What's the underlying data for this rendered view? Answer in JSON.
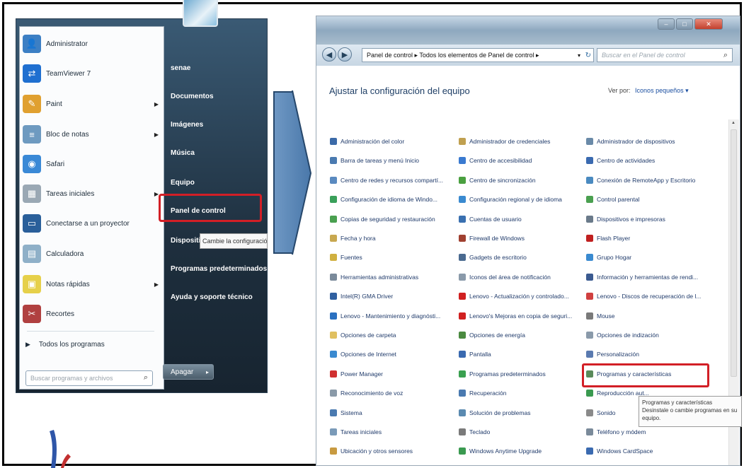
{
  "start_menu": {
    "items": [
      {
        "label": "Administrator",
        "icon": "administrator-icon",
        "color": "#3c7fc4",
        "arrow": false
      },
      {
        "label": "TeamViewer 7",
        "icon": "teamviewer-icon",
        "color": "#1f6fd0",
        "arrow": false
      },
      {
        "label": "Paint",
        "icon": "paint-icon",
        "color": "#e0a030",
        "arrow": true
      },
      {
        "label": "Bloc de notas",
        "icon": "notepad-icon",
        "color": "#6e9ac0",
        "arrow": true
      },
      {
        "label": "Safari",
        "icon": "safari-icon",
        "color": "#3a89d6",
        "arrow": false
      },
      {
        "label": "Tareas iniciales",
        "icon": "getting-started-icon",
        "color": "#9aa8b4",
        "arrow": true
      },
      {
        "label": "Conectarse a un proyector",
        "icon": "projector-icon",
        "color": "#2a5f9a",
        "arrow": false
      },
      {
        "label": "Calculadora",
        "icon": "calculator-icon",
        "color": "#8fb0c8",
        "arrow": false
      },
      {
        "label": "Notas rápidas",
        "icon": "sticky-notes-icon",
        "color": "#e6d04a",
        "arrow": true
      },
      {
        "label": "Recortes",
        "icon": "snipping-tool-icon",
        "color": "#b04040",
        "arrow": false
      }
    ],
    "all_programs": "Todos los programas",
    "search_placeholder": "Buscar programas y archivos",
    "right_links": [
      "senae",
      "Documentos",
      "Imágenes",
      "Música",
      "Equipo",
      "Panel de control",
      "Dispositivos",
      "Programas predeterminados",
      "Ayuda y soporte técnico"
    ],
    "tooltip": "Cambie la configuración",
    "shutdown": "Apagar"
  },
  "control_panel": {
    "address": "Panel de control  ▸  Todos los elementos de Panel de control  ▸",
    "search_placeholder": "Buscar en el Panel de control",
    "heading": "Ajustar la configuración del equipo",
    "view_label": "Ver por:",
    "view_value": "Iconos pequeños ▾",
    "columns": [
      [
        {
          "label": "Administración del color",
          "color": "#3b6aa8"
        },
        {
          "label": "Barra de tareas y menú Inicio",
          "color": "#4a7ab0"
        },
        {
          "label": "Centro de redes y recursos compartí...",
          "color": "#5a8ac0"
        },
        {
          "label": "Configuración de idioma de Windo...",
          "color": "#3aa05a"
        },
        {
          "label": "Copias de seguridad y restauración",
          "color": "#4aa050"
        },
        {
          "label": "Fecha y hora",
          "color": "#c8a850"
        },
        {
          "label": "Fuentes",
          "color": "#d0b040"
        },
        {
          "label": "Herramientas administrativas",
          "color": "#7a8a9a"
        },
        {
          "label": "Intel(R) GMA Driver",
          "color": "#3060a0"
        },
        {
          "label": "Lenovo - Mantenimiento y diagnósti...",
          "color": "#2a70c0"
        },
        {
          "label": "Opciones de carpeta",
          "color": "#e0c060"
        },
        {
          "label": "Opciones de Internet",
          "color": "#3a8ad0"
        },
        {
          "label": "Power Manager",
          "color": "#d03030"
        },
        {
          "label": "Reconocimiento de voz",
          "color": "#8a9aa8"
        },
        {
          "label": "Sistema",
          "color": "#4a7ab0"
        },
        {
          "label": "Tareas iniciales",
          "color": "#7a9ab8"
        },
        {
          "label": "Ubicación y otros sensores",
          "color": "#c89a40"
        }
      ],
      [
        {
          "label": "Administrador de credenciales",
          "color": "#c0a050"
        },
        {
          "label": "Centro de accesibilidad",
          "color": "#3a7ad0"
        },
        {
          "label": "Centro de sincronización",
          "color": "#4aa040"
        },
        {
          "label": "Configuración regional y de idioma",
          "color": "#3a8ad0"
        },
        {
          "label": "Cuentas de usuario",
          "color": "#3a70b0"
        },
        {
          "label": "Firewall de Windows",
          "color": "#a04030"
        },
        {
          "label": "Gadgets de escritorio",
          "color": "#4a6a90"
        },
        {
          "label": "Iconos del área de notificación",
          "color": "#8a9aaa"
        },
        {
          "label": "Lenovo - Actualización y controlado...",
          "color": "#d02020"
        },
        {
          "label": "Lenovo's Mejoras en copia de seguri...",
          "color": "#d02020"
        },
        {
          "label": "Opciones de energía",
          "color": "#4a8a40"
        },
        {
          "label": "Pantalla",
          "color": "#3a6ab0"
        },
        {
          "label": "Programas predeterminados",
          "color": "#3aa050"
        },
        {
          "label": "Recuperación",
          "color": "#4a7ab0"
        },
        {
          "label": "Solución de problemas",
          "color": "#5a8ab0"
        },
        {
          "label": "Teclado",
          "color": "#7a7a7a"
        },
        {
          "label": "Windows Anytime Upgrade",
          "color": "#3a9a50"
        }
      ],
      [
        {
          "label": "Administrador de dispositivos",
          "color": "#6a8aa8"
        },
        {
          "label": "Centro de actividades",
          "color": "#3a6ab0"
        },
        {
          "label": "Conexión de RemoteApp y Escritorio",
          "color": "#4a8ac0"
        },
        {
          "label": "Control parental",
          "color": "#4aa050"
        },
        {
          "label": "Dispositivos e impresoras",
          "color": "#6a7a8a"
        },
        {
          "label": "Flash Player",
          "color": "#c02020"
        },
        {
          "label": "Grupo Hogar",
          "color": "#3a8ad0"
        },
        {
          "label": "Información y herramientas de rendi...",
          "color": "#3a5a90"
        },
        {
          "label": "Lenovo - Discos de recuperación de l...",
          "color": "#d04040"
        },
        {
          "label": "Mouse",
          "color": "#7a7a7a"
        },
        {
          "label": "Opciones de indización",
          "color": "#8a9aaa"
        },
        {
          "label": "Personalización",
          "color": "#5a7ab0"
        },
        {
          "label": "Programas y características",
          "color": "#5a8a5a"
        },
        {
          "label": "Reproducción aut...",
          "color": "#3a9a50"
        },
        {
          "label": "Sonido",
          "color": "#8a8a8a"
        },
        {
          "label": "Teléfono y módem",
          "color": "#7a8a9a"
        },
        {
          "label": "Windows CardSpace",
          "color": "#3a6ab0"
        }
      ]
    ],
    "tooltip_title": "Programas y características",
    "tooltip_body": "Desinstale o cambie programas en su equipo."
  }
}
